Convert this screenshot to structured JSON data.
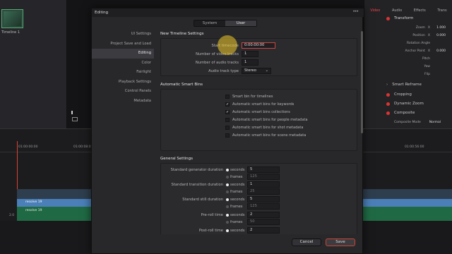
{
  "app": {
    "media_pool": {
      "clip_label": "Timeline 1"
    },
    "inspector": {
      "tabs": [
        "Video",
        "Audio",
        "Effects",
        "Trans"
      ],
      "transform": "Transform",
      "rows": [
        {
          "label": "Zoom",
          "axis": "X",
          "value": "1.000"
        },
        {
          "label": "Position",
          "axis": "X",
          "value": "0.000"
        },
        {
          "label": "Rotation Angle",
          "axis": "",
          "value": ""
        },
        {
          "label": "Anchor Point",
          "axis": "X",
          "value": "0.000"
        },
        {
          "label": "Pitch",
          "axis": "",
          "value": ""
        },
        {
          "label": "Yaw",
          "axis": "",
          "value": ""
        },
        {
          "label": "Flip",
          "axis": "",
          "value": ""
        }
      ],
      "sections": [
        "Smart Reframe",
        "Cropping",
        "Dynamic Zoom",
        "Composite"
      ],
      "composite_mode_label": "Composite Mode",
      "composite_mode_value": "Normal"
    },
    "timeline": {
      "tc1": "01:00:00:00",
      "tc2": "01:00:08:00",
      "tc3": "01:00:56:00",
      "clip1": "resolve 19",
      "clip2": "resolve 19",
      "track_num": "2.0"
    }
  },
  "dialog": {
    "title": "Editing",
    "menu_dots": "•••",
    "tabs": {
      "system": "System",
      "user": "User"
    },
    "nav": [
      "UI Settings",
      "Project Save and Load",
      "Editing",
      "Color",
      "Fairlight",
      "Playback Settings",
      "Control Panels",
      "Metadata"
    ],
    "new_timeline": {
      "title": "New Timeline Settings",
      "start_tc_label": "Start timecode",
      "start_tc_value": "0:00:00:00",
      "video_tracks_label": "Number of video tracks",
      "video_tracks_value": "1",
      "audio_tracks_label": "Number of audio tracks",
      "audio_tracks_value": "1",
      "audio_type_label": "Audio track type",
      "audio_type_value": "Stereo"
    },
    "smart_bins": {
      "title": "Automatic Smart Bins",
      "items": [
        {
          "label": "Smart bin for timelines",
          "checked": false
        },
        {
          "label": "Automatic smart bins for keywords",
          "checked": true
        },
        {
          "label": "Automatic smart bins collections",
          "checked": true
        },
        {
          "label": "Automatic smart bins for people metadata",
          "checked": false
        },
        {
          "label": "Automatic smart bins for shot metadata",
          "checked": false
        },
        {
          "label": "Automatic smart bins for scene metadata",
          "checked": false
        }
      ]
    },
    "general": {
      "title": "General Settings",
      "seconds": "seconds",
      "frames": "frames",
      "rows": [
        {
          "label": "Standard generator duration",
          "sec": "5",
          "frames": "125"
        },
        {
          "label": "Standard transition duration",
          "sec": "1",
          "frames": "25"
        },
        {
          "label": "Standard still duration",
          "sec": "5",
          "frames": "125"
        },
        {
          "label": "Pre-roll time",
          "sec": "2",
          "frames": "50"
        },
        {
          "label": "Post-roll time",
          "sec": "2",
          "frames": "50"
        }
      ]
    },
    "cancel": "Cancel",
    "save": "Save"
  }
}
